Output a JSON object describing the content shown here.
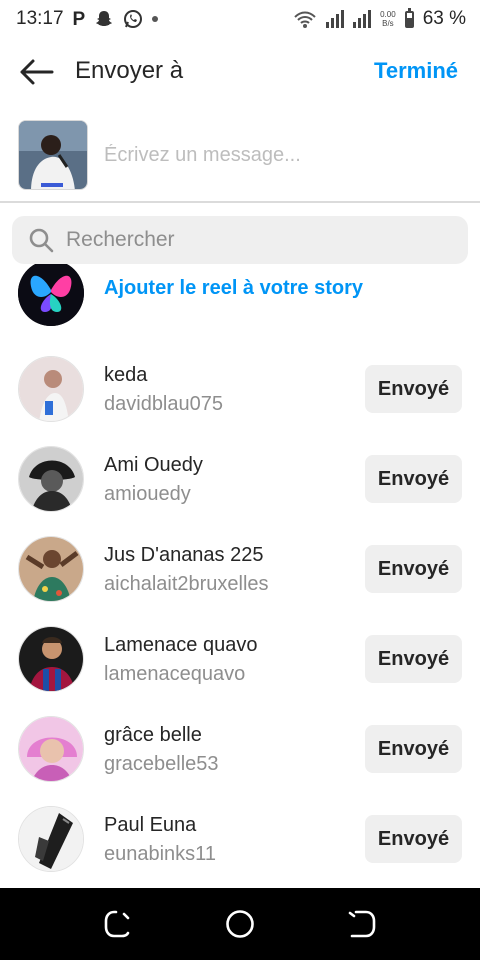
{
  "status_bar": {
    "time": "13:17",
    "app_glyph": "P",
    "speed_top": "0.00",
    "speed_bottom": "B/s",
    "battery": "63 %"
  },
  "header": {
    "title": "Envoyer à",
    "done_label": "Terminé"
  },
  "composer": {
    "placeholder": "Écrivez un message..."
  },
  "search": {
    "placeholder": "Rechercher"
  },
  "story": {
    "label": "Ajouter le reel à votre story"
  },
  "contacts": [
    {
      "name": "keda",
      "username": "davidblau075",
      "action": "Envoyé"
    },
    {
      "name": "Ami Ouedy",
      "username": "amiouedy",
      "action": "Envoyé"
    },
    {
      "name": "Jus D'ananas 225",
      "username": "aichalait2bruxelles",
      "action": "Envoyé"
    },
    {
      "name": "Lamenace quavo",
      "username": "lamenacequavo",
      "action": "Envoyé"
    },
    {
      "name": "grâce belle",
      "username": "gracebelle53",
      "action": "Envoyé"
    },
    {
      "name": "Paul Euna",
      "username": "eunabinks11",
      "action": "Envoyé"
    }
  ],
  "colors": {
    "accent": "#0095f6",
    "button_bg": "#efefef",
    "secondary_text": "#8e8e8e"
  },
  "icons": {
    "back": "arrow-left-icon",
    "search": "search-icon",
    "nav_recents": "recents-icon",
    "nav_home": "home-circle-icon",
    "nav_back": "nav-back-icon"
  }
}
